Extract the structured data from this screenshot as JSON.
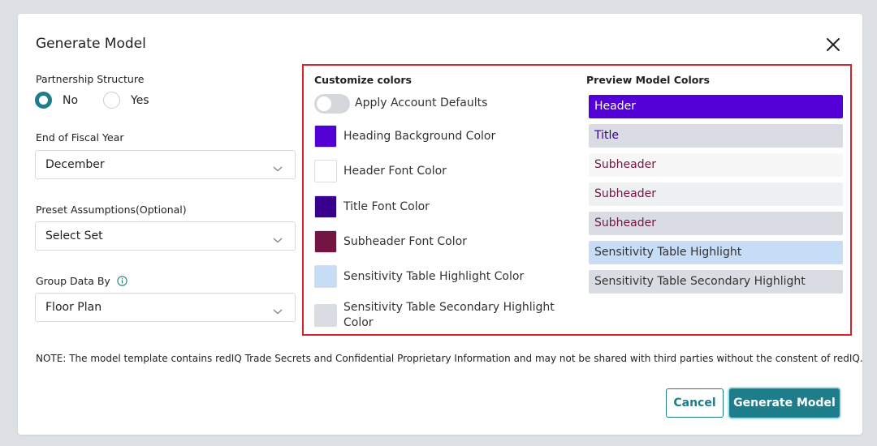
{
  "modal": {
    "title": "Generate Model"
  },
  "partnership": {
    "label": "Partnership Structure",
    "options": [
      "No",
      "Yes"
    ],
    "selected": "No"
  },
  "fiscal_year": {
    "label": "End of Fiscal Year",
    "value": "December"
  },
  "preset": {
    "label": "Preset Assumptions(Optional)",
    "value": "Select Set"
  },
  "group_by": {
    "label": "Group Data By",
    "value": "Floor Plan"
  },
  "customize": {
    "heading": "Customize colors",
    "toggle_label": "Apply Account Defaults",
    "toggle_on": false,
    "items": [
      {
        "label": "Heading Background Color",
        "color": "#5200d6"
      },
      {
        "label": "Header Font Color",
        "color": "#ffffff"
      },
      {
        "label": "Title Font Color",
        "color": "#38008c"
      },
      {
        "label": "Subheader Font Color",
        "color": "#731442"
      },
      {
        "label": "Sensitivity Table Highlight Color",
        "color": "#c7dcf5"
      },
      {
        "label": "Sensitivity Table Secondary Highlight Color",
        "color": "#d9dde3"
      }
    ]
  },
  "preview": {
    "heading": "Preview Model Colors",
    "rows": [
      {
        "label": "Header",
        "bg": "#5200d6",
        "fg": "#ffffff"
      },
      {
        "label": "Title",
        "bg": "#d9dde3",
        "fg": "#38008c"
      },
      {
        "label": "Subheader",
        "bg": "#f7f7f8",
        "fg": "#731442"
      },
      {
        "label": "Subheader",
        "bg": "#eef0f2",
        "fg": "#731442"
      },
      {
        "label": "Subheader",
        "bg": "#d9dde3",
        "fg": "#731442"
      },
      {
        "label": "Sensitivity Table Highlight",
        "bg": "#c7dcf5",
        "fg": "#333333"
      },
      {
        "label": "Sensitivity Table Secondary Highlight",
        "bg": "#d9dde3",
        "fg": "#333333"
      }
    ]
  },
  "note": "NOTE: The model template contains redIQ Trade Secrets and Confidential Proprietary Information and may not be shared with third parties without the constent of redIQ.",
  "buttons": {
    "cancel": "Cancel",
    "generate": "Generate Model"
  }
}
